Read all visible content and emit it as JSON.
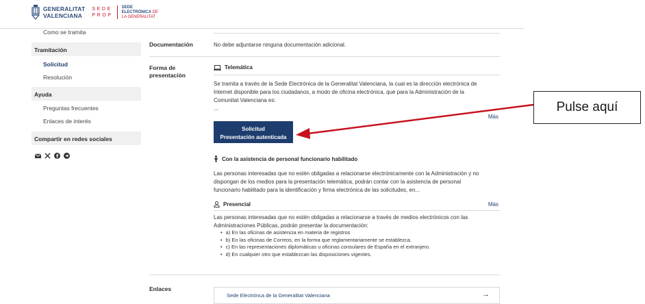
{
  "header": {
    "logo_line1": "GENERALITAT",
    "logo_line2": "VALENCIANA",
    "sede_line1": "SEDE",
    "sede_line2": "PROP",
    "elec_line1": "SEDE",
    "elec_line2a": "ELECTRÒNICA",
    "elec_line2b": "DE",
    "elec_line3": "LA GENERALITAT"
  },
  "sidebar": {
    "cut_item": "Como se tramita",
    "sections": [
      {
        "title": "Tramitación",
        "items": [
          "Solicitud",
          "Resolución"
        ]
      },
      {
        "title": "Ayuda",
        "items": [
          "Preguntas frecuentes",
          "Enlaces de interés"
        ]
      },
      {
        "title": "Compartir en redes sociales",
        "items": []
      }
    ],
    "social_icons": [
      "email-icon",
      "x-icon",
      "facebook-icon",
      "telegram-icon"
    ]
  },
  "main": {
    "documentacion": {
      "label": "Documentación",
      "text": "No debe adjuntarse ninguna documentación adicional."
    },
    "forma": {
      "label_line1": "Forma de",
      "label_line2": "presentación",
      "telematica": {
        "title": "Telemática",
        "text1": "Se tramita a través de la Sede Electrónica de la Generalitat Valenciana, la cual es la dirección electrónica de",
        "text2": "Internet disponible para los ciudadanos, a modo de oficina electrónica, que para la Administración de la",
        "text3": "Comunitat Valenciana es:",
        "ellipsis": "...",
        "more": "Más",
        "button_line1": "Solicitud",
        "button_line2": "Presentación autenticada"
      },
      "asistencia": {
        "title": "Con la asistencia de personal funcionario habilitado",
        "text1": "Las personas interesadas que no estén obligadas a relacionarse electrónicamente con la Administración y no",
        "text2": "dispongan de los medios para la presentación telemática, podrán contar con la asistencia de personal",
        "text3": "funcionario habilitado para la identificación y firma electrónica de las solicitudes, en..."
      },
      "presencial": {
        "title": "Presencial",
        "more": "Más",
        "text1": "Las personas interesadas que no estén obligadas a relacionarse a través de medios electrónicos con las",
        "text2": "Administraciones Públicas, podrán presentar la documentación:",
        "bullets": [
          "a) En las oficinas de asistencia en materia de registros",
          "b) En las oficinas de Correos, en la forma que reglamentariamente se establezca.",
          "c) En las representaciones diplomáticas u oficinas consulares de España en el extranjero.",
          "d) En cualquier otro que establezcan las disposiciones vigentes."
        ]
      }
    },
    "enlaces": {
      "label": "Enlaces",
      "link": "Sede Electrónca de la Generalitat Valenciana"
    }
  },
  "annotation": {
    "callout": "Pulse aquí",
    "arrow_color": "#c8101e"
  }
}
